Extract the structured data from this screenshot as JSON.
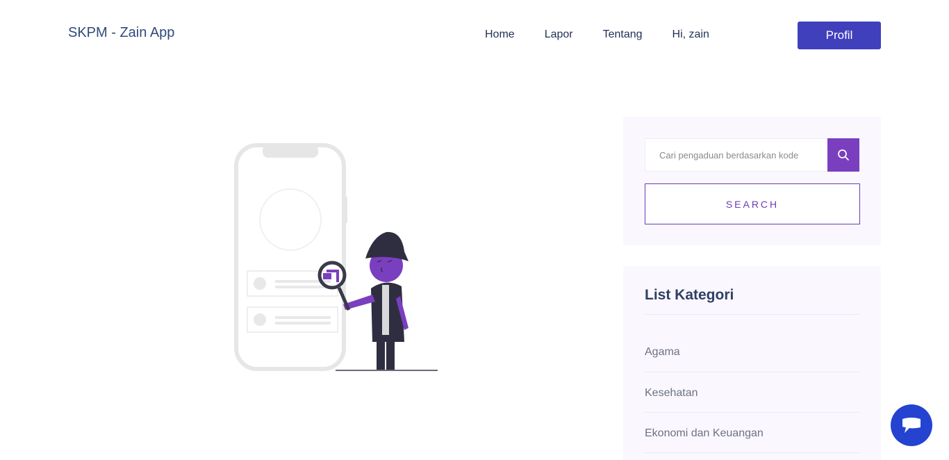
{
  "navbar": {
    "brand": "SKPM - Zain App",
    "links": [
      "Home",
      "Lapor",
      "Tentang",
      "Hi, zain"
    ],
    "profile_button": "Profil"
  },
  "search": {
    "placeholder": "Cari pengaduan berdasarkan kode",
    "button_label": "SEARCH",
    "icon": "search-icon"
  },
  "categories": {
    "title": "List Kategori",
    "items": [
      "Agama",
      "Kesehatan",
      "Ekonomi dan Keuangan"
    ]
  },
  "chat": {
    "icon": "chat-icon"
  },
  "colors": {
    "primary": "#4040bd",
    "accent": "#7a3fbf",
    "chat": "#2443d1"
  }
}
